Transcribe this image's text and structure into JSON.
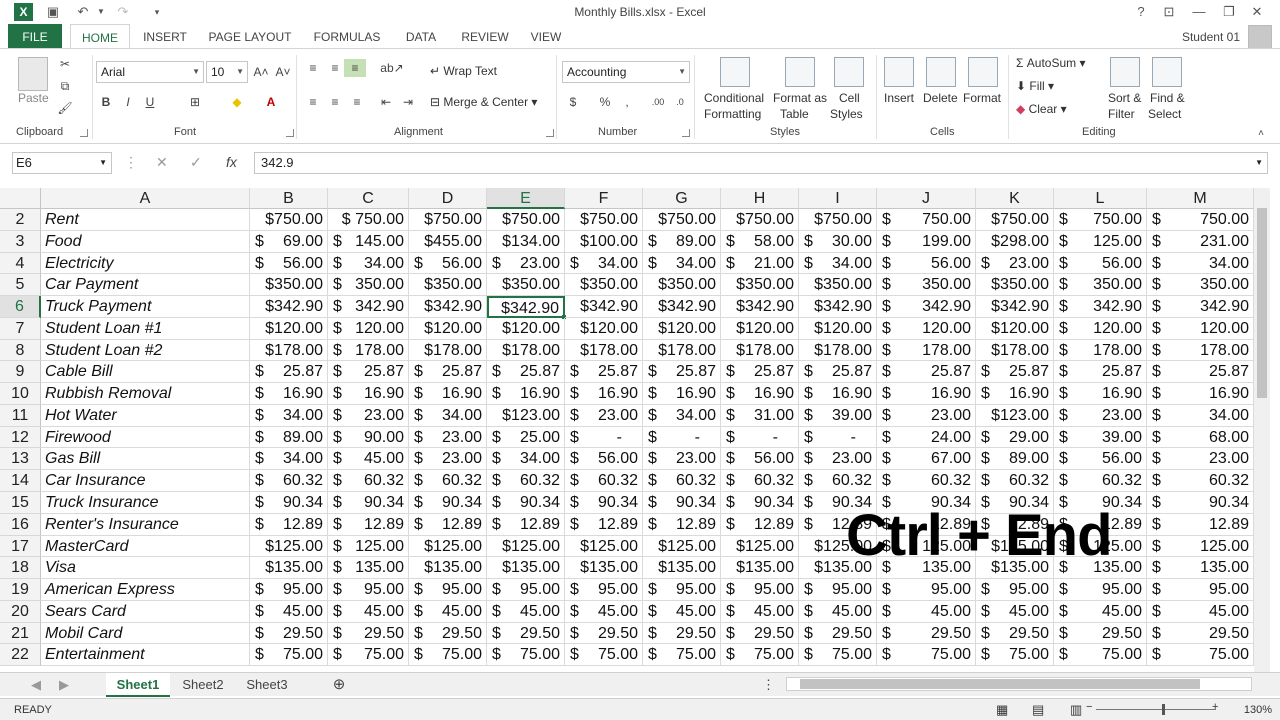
{
  "window": {
    "title": "Monthly Bills.xlsx - Excel",
    "help": "?",
    "minimize": "—",
    "restore": "❐",
    "close": "✕"
  },
  "ribbon_tabs": [
    "FILE",
    "HOME",
    "INSERT",
    "PAGE LAYOUT",
    "FORMULAS",
    "DATA",
    "REVIEW",
    "VIEW"
  ],
  "user": "Student 01",
  "ribbon": {
    "clipboard": {
      "paste": "Paste",
      "label": "Clipboard"
    },
    "font": {
      "name": "Arial",
      "size": "10",
      "bold": "B",
      "italic": "I",
      "underline": "U",
      "label": "Font"
    },
    "alignment": {
      "wrap": "Wrap Text",
      "merge": "Merge & Center",
      "label": "Alignment"
    },
    "number": {
      "format": "Accounting",
      "currency": "$",
      "percent": "%",
      "comma": ",",
      "label": "Number"
    },
    "styles": {
      "conditional": "Conditional",
      "conditional2": "Formatting",
      "format_table": "Format as",
      "format_table2": "Table",
      "cell_styles": "Cell",
      "cell_styles2": "Styles",
      "label": "Styles"
    },
    "cells": {
      "insert": "Insert",
      "delete": "Delete",
      "format": "Format",
      "label": "Cells"
    },
    "editing": {
      "autosum": "AutoSum",
      "fill": "Fill",
      "clear": "Clear",
      "sort": "Sort &",
      "sort2": "Filter",
      "find": "Find &",
      "find2": "Select",
      "label": "Editing"
    }
  },
  "formula_bar": {
    "name_box": "E6",
    "formula": "342.9"
  },
  "columns": [
    "A",
    "B",
    "C",
    "D",
    "E",
    "F",
    "G",
    "H",
    "I",
    "J",
    "K",
    "L",
    "M"
  ],
  "selected_cell": "E6",
  "rows": [
    {
      "num": "2",
      "label": "Rent",
      "cells": [
        [
          "$750.00",
          ""
        ],
        [
          "$ 750.00",
          ""
        ],
        [
          "$750.00",
          ""
        ],
        [
          "$750.00",
          ""
        ],
        [
          "$750.00",
          ""
        ],
        [
          "$750.00",
          ""
        ],
        [
          "$750.00",
          ""
        ],
        [
          "$750.00",
          ""
        ],
        [
          "$",
          "750.00"
        ],
        [
          "$750.00",
          ""
        ],
        [
          "$",
          "750.00"
        ],
        [
          "$",
          "750.00"
        ]
      ]
    },
    {
      "num": "3",
      "label": "Food",
      "cells": [
        [
          "$",
          "69.00"
        ],
        [
          "$",
          "145.00"
        ],
        [
          "$455.00",
          ""
        ],
        [
          "$134.00",
          ""
        ],
        [
          "$100.00",
          ""
        ],
        [
          "$",
          "89.00"
        ],
        [
          "$",
          "58.00"
        ],
        [
          "$",
          "30.00"
        ],
        [
          "$",
          "199.00"
        ],
        [
          "$298.00",
          ""
        ],
        [
          "$",
          "125.00"
        ],
        [
          "$",
          "231.00"
        ]
      ]
    },
    {
      "num": "4",
      "label": "Electricity",
      "cells": [
        [
          "$",
          "56.00"
        ],
        [
          "$",
          "34.00"
        ],
        [
          "$",
          "56.00"
        ],
        [
          "$",
          "23.00"
        ],
        [
          "$",
          "34.00"
        ],
        [
          "$",
          "34.00"
        ],
        [
          "$",
          "21.00"
        ],
        [
          "$",
          "34.00"
        ],
        [
          "$",
          "56.00"
        ],
        [
          "$",
          "23.00"
        ],
        [
          "$",
          "56.00"
        ],
        [
          "$",
          "34.00"
        ]
      ]
    },
    {
      "num": "5",
      "label": "Car Payment",
      "cells": [
        [
          "$350.00",
          ""
        ],
        [
          "$",
          "350.00"
        ],
        [
          "$350.00",
          ""
        ],
        [
          "$350.00",
          ""
        ],
        [
          "$350.00",
          ""
        ],
        [
          "$350.00",
          ""
        ],
        [
          "$350.00",
          ""
        ],
        [
          "$350.00",
          ""
        ],
        [
          "$",
          "350.00"
        ],
        [
          "$350.00",
          ""
        ],
        [
          "$",
          "350.00"
        ],
        [
          "$",
          "350.00"
        ]
      ]
    },
    {
      "num": "6",
      "label": "Truck Payment",
      "cells": [
        [
          "$342.90",
          ""
        ],
        [
          "$",
          "342.90"
        ],
        [
          "$342.90",
          ""
        ],
        [
          "$342.90",
          ""
        ],
        [
          "$342.90",
          ""
        ],
        [
          "$342.90",
          ""
        ],
        [
          "$342.90",
          ""
        ],
        [
          "$342.90",
          ""
        ],
        [
          "$",
          "342.90"
        ],
        [
          "$342.90",
          ""
        ],
        [
          "$",
          "342.90"
        ],
        [
          "$",
          "342.90"
        ]
      ]
    },
    {
      "num": "7",
      "label": "Student Loan #1",
      "cells": [
        [
          "$120.00",
          ""
        ],
        [
          "$",
          "120.00"
        ],
        [
          "$120.00",
          ""
        ],
        [
          "$120.00",
          ""
        ],
        [
          "$120.00",
          ""
        ],
        [
          "$120.00",
          ""
        ],
        [
          "$120.00",
          ""
        ],
        [
          "$120.00",
          ""
        ],
        [
          "$",
          "120.00"
        ],
        [
          "$120.00",
          ""
        ],
        [
          "$",
          "120.00"
        ],
        [
          "$",
          "120.00"
        ]
      ]
    },
    {
      "num": "8",
      "label": "Student Loan #2",
      "cells": [
        [
          "$178.00",
          ""
        ],
        [
          "$",
          "178.00"
        ],
        [
          "$178.00",
          ""
        ],
        [
          "$178.00",
          ""
        ],
        [
          "$178.00",
          ""
        ],
        [
          "$178.00",
          ""
        ],
        [
          "$178.00",
          ""
        ],
        [
          "$178.00",
          ""
        ],
        [
          "$",
          "178.00"
        ],
        [
          "$178.00",
          ""
        ],
        [
          "$",
          "178.00"
        ],
        [
          "$",
          "178.00"
        ]
      ]
    },
    {
      "num": "9",
      "label": "Cable Bill",
      "cells": [
        [
          "$",
          "25.87"
        ],
        [
          "$",
          "25.87"
        ],
        [
          "$",
          "25.87"
        ],
        [
          "$",
          "25.87"
        ],
        [
          "$",
          "25.87"
        ],
        [
          "$",
          "25.87"
        ],
        [
          "$",
          "25.87"
        ],
        [
          "$",
          "25.87"
        ],
        [
          "$",
          "25.87"
        ],
        [
          "$",
          "25.87"
        ],
        [
          "$",
          "25.87"
        ],
        [
          "$",
          "25.87"
        ]
      ]
    },
    {
      "num": "10",
      "label": "Rubbish Removal",
      "cells": [
        [
          "$",
          "16.90"
        ],
        [
          "$",
          "16.90"
        ],
        [
          "$",
          "16.90"
        ],
        [
          "$",
          "16.90"
        ],
        [
          "$",
          "16.90"
        ],
        [
          "$",
          "16.90"
        ],
        [
          "$",
          "16.90"
        ],
        [
          "$",
          "16.90"
        ],
        [
          "$",
          "16.90"
        ],
        [
          "$",
          "16.90"
        ],
        [
          "$",
          "16.90"
        ],
        [
          "$",
          "16.90"
        ]
      ]
    },
    {
      "num": "11",
      "label": "Hot Water",
      "cells": [
        [
          "$",
          "34.00"
        ],
        [
          "$",
          "23.00"
        ],
        [
          "$",
          "34.00"
        ],
        [
          "$123.00",
          ""
        ],
        [
          "$",
          "23.00"
        ],
        [
          "$",
          "34.00"
        ],
        [
          "$",
          "31.00"
        ],
        [
          "$",
          "39.00"
        ],
        [
          "$",
          "23.00"
        ],
        [
          "$123.00",
          ""
        ],
        [
          "$",
          "23.00"
        ],
        [
          "$",
          "34.00"
        ]
      ]
    },
    {
      "num": "12",
      "label": "Firewood",
      "cells": [
        [
          "$",
          "89.00"
        ],
        [
          "$",
          "90.00"
        ],
        [
          "$",
          "23.00"
        ],
        [
          "$",
          "25.00"
        ],
        [
          "$",
          "-"
        ],
        [
          "$",
          "-"
        ],
        [
          "$",
          "-"
        ],
        [
          "$",
          "-"
        ],
        [
          "$",
          "24.00"
        ],
        [
          "$",
          "29.00"
        ],
        [
          "$",
          "39.00"
        ],
        [
          "$",
          "68.00"
        ]
      ]
    },
    {
      "num": "13",
      "label": "Gas Bill",
      "cells": [
        [
          "$",
          "34.00"
        ],
        [
          "$",
          "45.00"
        ],
        [
          "$",
          "23.00"
        ],
        [
          "$",
          "34.00"
        ],
        [
          "$",
          "56.00"
        ],
        [
          "$",
          "23.00"
        ],
        [
          "$",
          "56.00"
        ],
        [
          "$",
          "23.00"
        ],
        [
          "$",
          "67.00"
        ],
        [
          "$",
          "89.00"
        ],
        [
          "$",
          "56.00"
        ],
        [
          "$",
          "23.00"
        ]
      ]
    },
    {
      "num": "14",
      "label": "Car Insurance",
      "cells": [
        [
          "$",
          "60.32"
        ],
        [
          "$",
          "60.32"
        ],
        [
          "$",
          "60.32"
        ],
        [
          "$",
          "60.32"
        ],
        [
          "$",
          "60.32"
        ],
        [
          "$",
          "60.32"
        ],
        [
          "$",
          "60.32"
        ],
        [
          "$",
          "60.32"
        ],
        [
          "$",
          "60.32"
        ],
        [
          "$",
          "60.32"
        ],
        [
          "$",
          "60.32"
        ],
        [
          "$",
          "60.32"
        ]
      ]
    },
    {
      "num": "15",
      "label": "Truck Insurance",
      "cells": [
        [
          "$",
          "90.34"
        ],
        [
          "$",
          "90.34"
        ],
        [
          "$",
          "90.34"
        ],
        [
          "$",
          "90.34"
        ],
        [
          "$",
          "90.34"
        ],
        [
          "$",
          "90.34"
        ],
        [
          "$",
          "90.34"
        ],
        [
          "$",
          "90.34"
        ],
        [
          "$",
          "90.34"
        ],
        [
          "$",
          "90.34"
        ],
        [
          "$",
          "90.34"
        ],
        [
          "$",
          "90.34"
        ]
      ]
    },
    {
      "num": "16",
      "label": "Renter's Insurance",
      "cells": [
        [
          "$",
          "12.89"
        ],
        [
          "$",
          "12.89"
        ],
        [
          "$",
          "12.89"
        ],
        [
          "$",
          "12.89"
        ],
        [
          "$",
          "12.89"
        ],
        [
          "$",
          "12.89"
        ],
        [
          "$",
          "12.89"
        ],
        [
          "$",
          "12.89"
        ],
        [
          "$",
          "12.89"
        ],
        [
          "$",
          "12.89"
        ],
        [
          "$",
          "12.89"
        ],
        [
          "$",
          "12.89"
        ]
      ]
    },
    {
      "num": "17",
      "label": "MasterCard",
      "cells": [
        [
          "$125.00",
          ""
        ],
        [
          "$",
          "125.00"
        ],
        [
          "$125.00",
          ""
        ],
        [
          "$125.00",
          ""
        ],
        [
          "$125.00",
          ""
        ],
        [
          "$125.00",
          ""
        ],
        [
          "$125.00",
          ""
        ],
        [
          "$125.00",
          ""
        ],
        [
          "$",
          "125.00"
        ],
        [
          "$125.00",
          ""
        ],
        [
          "$",
          "125.00"
        ],
        [
          "$",
          "125.00"
        ]
      ]
    },
    {
      "num": "18",
      "label": "Visa",
      "cells": [
        [
          "$135.00",
          ""
        ],
        [
          "$",
          "135.00"
        ],
        [
          "$135.00",
          ""
        ],
        [
          "$135.00",
          ""
        ],
        [
          "$135.00",
          ""
        ],
        [
          "$135.00",
          ""
        ],
        [
          "$135.00",
          ""
        ],
        [
          "$135.00",
          ""
        ],
        [
          "$",
          "135.00"
        ],
        [
          "$135.00",
          ""
        ],
        [
          "$",
          "135.00"
        ],
        [
          "$",
          "135.00"
        ]
      ]
    },
    {
      "num": "19",
      "label": "American Express",
      "cells": [
        [
          "$",
          "95.00"
        ],
        [
          "$",
          "95.00"
        ],
        [
          "$",
          "95.00"
        ],
        [
          "$",
          "95.00"
        ],
        [
          "$",
          "95.00"
        ],
        [
          "$",
          "95.00"
        ],
        [
          "$",
          "95.00"
        ],
        [
          "$",
          "95.00"
        ],
        [
          "$",
          "95.00"
        ],
        [
          "$",
          "95.00"
        ],
        [
          "$",
          "95.00"
        ],
        [
          "$",
          "95.00"
        ]
      ]
    },
    {
      "num": "20",
      "label": "Sears Card",
      "cells": [
        [
          "$",
          "45.00"
        ],
        [
          "$",
          "45.00"
        ],
        [
          "$",
          "45.00"
        ],
        [
          "$",
          "45.00"
        ],
        [
          "$",
          "45.00"
        ],
        [
          "$",
          "45.00"
        ],
        [
          "$",
          "45.00"
        ],
        [
          "$",
          "45.00"
        ],
        [
          "$",
          "45.00"
        ],
        [
          "$",
          "45.00"
        ],
        [
          "$",
          "45.00"
        ],
        [
          "$",
          "45.00"
        ]
      ]
    },
    {
      "num": "21",
      "label": "Mobil Card",
      "cells": [
        [
          "$",
          "29.50"
        ],
        [
          "$",
          "29.50"
        ],
        [
          "$",
          "29.50"
        ],
        [
          "$",
          "29.50"
        ],
        [
          "$",
          "29.50"
        ],
        [
          "$",
          "29.50"
        ],
        [
          "$",
          "29.50"
        ],
        [
          "$",
          "29.50"
        ],
        [
          "$",
          "29.50"
        ],
        [
          "$",
          "29.50"
        ],
        [
          "$",
          "29.50"
        ],
        [
          "$",
          "29.50"
        ]
      ]
    },
    {
      "num": "22",
      "label": "Entertainment",
      "cells": [
        [
          "$",
          "75.00"
        ],
        [
          "$",
          "75.00"
        ],
        [
          "$",
          "75.00"
        ],
        [
          "$",
          "75.00"
        ],
        [
          "$",
          "75.00"
        ],
        [
          "$",
          "75.00"
        ],
        [
          "$",
          "75.00"
        ],
        [
          "$",
          "75.00"
        ],
        [
          "$",
          "75.00"
        ],
        [
          "$",
          "75.00"
        ],
        [
          "$",
          "75.00"
        ],
        [
          "$",
          "75.00"
        ]
      ]
    }
  ],
  "overlay_caption": "Ctrl + End",
  "sheets": [
    "Sheet1",
    "Sheet2",
    "Sheet3"
  ],
  "active_sheet": "Sheet1",
  "status": {
    "mode": "READY",
    "zoom": "130%"
  },
  "colors": {
    "accent": "#217346",
    "header_bg": "#f3f3f3"
  }
}
